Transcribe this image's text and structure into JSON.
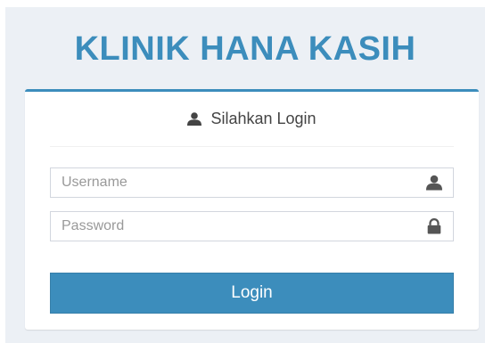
{
  "brand": {
    "title": "KLINIK HANA KASIH"
  },
  "login_box": {
    "header_icon": "user-icon",
    "header_text": "Silahkan Login",
    "username": {
      "placeholder": "Username",
      "value": "",
      "icon": "user-icon"
    },
    "password": {
      "placeholder": "Password",
      "value": "",
      "icon": "lock-icon"
    },
    "submit_label": "Login"
  },
  "colors": {
    "accent": "#3c8dbc",
    "background": "#ecf0f5",
    "panel": "#ffffff",
    "border": "#d2d6de"
  }
}
